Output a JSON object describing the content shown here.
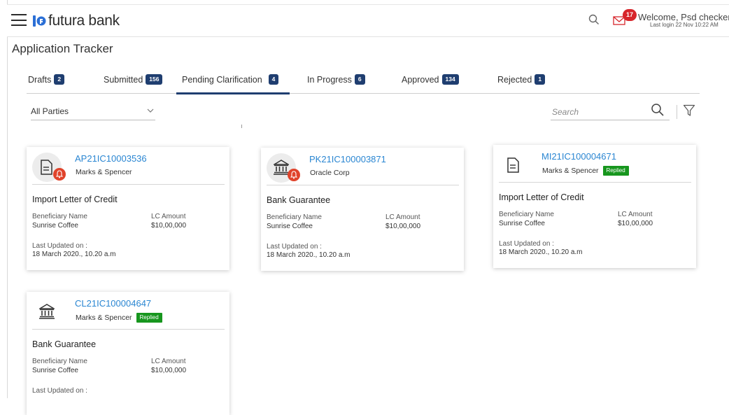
{
  "header": {
    "brand": "futura bank",
    "mail_count": "17",
    "welcome": "Welcome, Psd checker",
    "last_login": "Last login 22 Nov 10:22 AM"
  },
  "page_title": "Application Tracker",
  "tabs": [
    {
      "label": "Drafts",
      "count": "2"
    },
    {
      "label": "Submitted",
      "count": "156"
    },
    {
      "label": "Pending Clarification",
      "count": "4",
      "active": true
    },
    {
      "label": "In Progress",
      "count": "6"
    },
    {
      "label": "Approved",
      "count": "134"
    },
    {
      "label": "Rejected",
      "count": "1"
    }
  ],
  "filters": {
    "parties_selected": "All Parties",
    "search_placeholder": "Search"
  },
  "cards": [
    {
      "ref": "AP21IC10003536",
      "party": "Marks & Spencer",
      "icon": "document-icon",
      "alert": true,
      "replied": "",
      "product": "Import Letter of Credit",
      "beneficiary_label": "Beneficiary Name",
      "beneficiary": "Sunrise Coffee",
      "amount_label": "LC Amount",
      "amount": "$10,00,000",
      "updated_label": "Last Updated on :",
      "updated": "18 March 2020., 10.20 a.m"
    },
    {
      "ref": "PK21IC100003871",
      "party": "Oracle Corp",
      "icon": "bank-icon",
      "alert": true,
      "replied": "",
      "product": "Bank Guarantee",
      "beneficiary_label": "Beneficiary Name",
      "beneficiary": "Sunrise Coffee",
      "amount_label": "LC Amount",
      "amount": "$10,00,000",
      "updated_label": "Last Updated on :",
      "updated": "18 March 2020., 10.20 a.m"
    },
    {
      "ref": "MI21IC100004671",
      "party": "Marks & Spencer",
      "icon": "document-icon",
      "alert": false,
      "replied": "Replied",
      "product": "Import Letter of Credit",
      "beneficiary_label": "Beneficiary Name",
      "beneficiary": "Sunrise Coffee",
      "amount_label": "LC Amount",
      "amount": "$10,00,000",
      "updated_label": "Last Updated on :",
      "updated": "18 March 2020., 10.20 a.m"
    },
    {
      "ref": "CL21IC100004647",
      "party": "Marks & Spencer",
      "icon": "bank-icon",
      "alert": false,
      "replied": "Replied",
      "product": "Bank Guarantee",
      "beneficiary_label": "Beneficiary Name",
      "beneficiary": "Sunrise Coffee",
      "amount_label": "LC Amount",
      "amount": "$10,00,000",
      "updated_label": "Last Updated on :",
      "updated": ""
    }
  ],
  "colors": {
    "accent": "#1f3e70",
    "link": "#2a86d2",
    "replied": "#17961e",
    "alert": "#e0432b",
    "brand": "#2b6fd6"
  }
}
